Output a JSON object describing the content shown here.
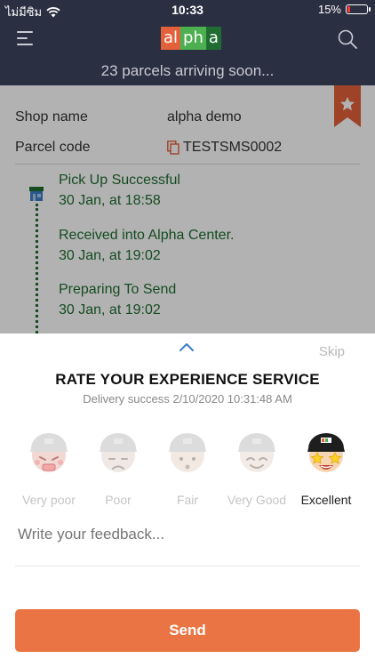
{
  "status_bar": {
    "carrier": "ไม่มีซิม",
    "time": "10:33",
    "battery": "15%",
    "battery_level": 0.15
  },
  "header": {
    "logo_parts": [
      "al",
      "ph",
      "a"
    ],
    "logo_colors": [
      "#e3613a",
      "#4caf50",
      "#1f6d32"
    ]
  },
  "banner": "23 parcels arriving soon...",
  "parcel": {
    "shop_label": "Shop name",
    "shop_value": "alpha demo",
    "code_label": "Parcel code",
    "code_value": "TESTSMS0002"
  },
  "timeline": [
    {
      "status": "Pick Up Successful",
      "time": "30 Jan, at 18:58"
    },
    {
      "status": "Received into Alpha Center.",
      "time": "30 Jan, at 19:02"
    },
    {
      "status": "Preparing To Send",
      "time": "30 Jan, at 19:02"
    }
  ],
  "rating": {
    "skip": "Skip",
    "title": "RATE YOUR EXPERIENCE SERVICE",
    "subtitle": "Delivery success 2/10/2020 10:31:48 AM",
    "options": [
      {
        "label": "Very poor",
        "icon": "angry-face-icon",
        "selected": false
      },
      {
        "label": "Poor",
        "icon": "sad-face-icon",
        "selected": false
      },
      {
        "label": "Fair",
        "icon": "neutral-face-icon",
        "selected": false
      },
      {
        "label": "Very Good",
        "icon": "happy-face-icon",
        "selected": false
      },
      {
        "label": "Excellent",
        "icon": "star-eyes-face-icon",
        "selected": true
      }
    ],
    "feedback_placeholder": "Write your feedback...",
    "send": "Send"
  },
  "colors": {
    "header_bg": "#2b2f42",
    "accent": "#ea7443",
    "timeline_green": "#1f6d32"
  }
}
